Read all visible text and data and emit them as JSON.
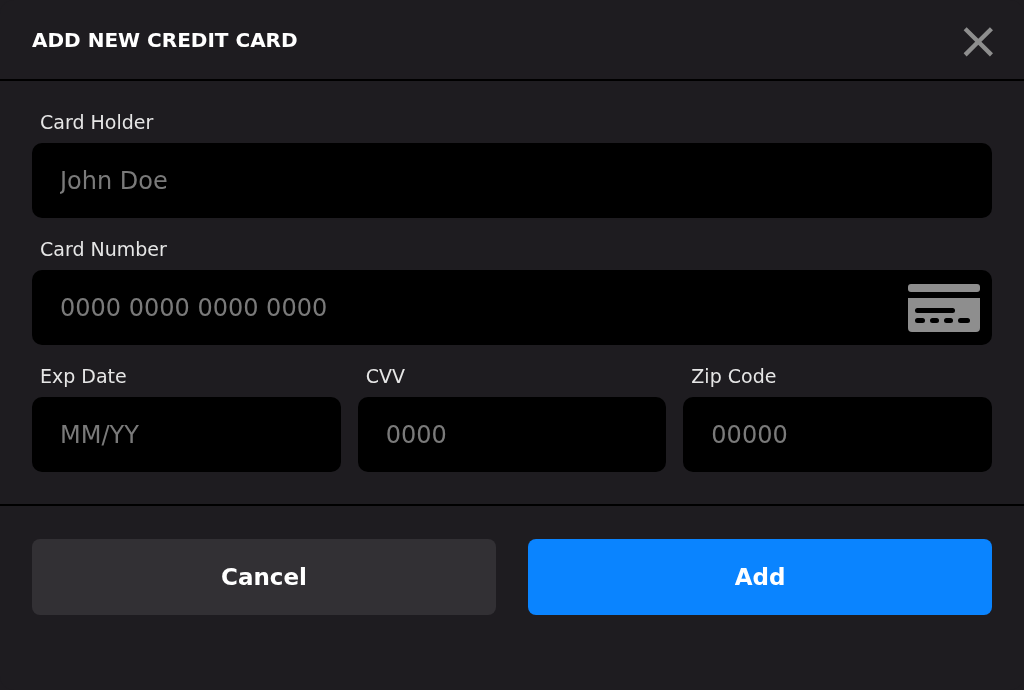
{
  "dialog": {
    "title": "ADD NEW CREDIT CARD",
    "close": "×"
  },
  "fields": [
    {
      "label": "Card Holder",
      "placeholder": "John Doe",
      "kind": "text"
    },
    {
      "label": "Card Number",
      "placeholder": "0000 0000 0000 0000",
      "kind": "card"
    }
  ],
  "row_fields": [
    {
      "label": "Exp Date",
      "placeholder": "MM/YY"
    },
    {
      "label": "CVV",
      "placeholder": "0000"
    },
    {
      "label": "Zip Code",
      "placeholder": "00000"
    }
  ],
  "buttons": [
    {
      "label": "Cancel",
      "kind": "secondary"
    },
    {
      "label": "Add",
      "kind": "primary"
    }
  ]
}
